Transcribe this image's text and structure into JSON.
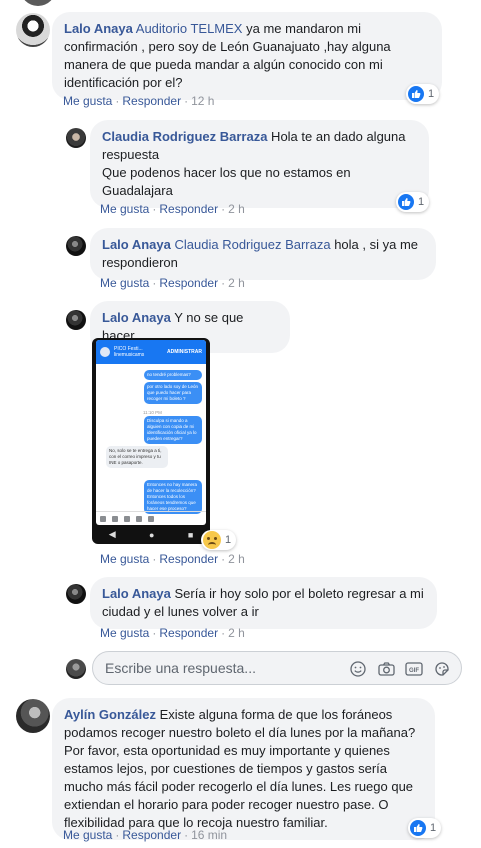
{
  "comments": [
    {
      "author": "Lalo Anaya",
      "mention": "Auditorio TELMEX",
      "text": " ya me mandaron mi confirmación , pero soy de León Guanajuato ,hay alguna manera de que pueda mandar a algún conocido con mi identificación por el?",
      "like_label": "Me gusta",
      "reply_label": "Responder",
      "time": "12 h",
      "reaction_count": "1"
    },
    {
      "author": "Claudia Rodriguez Barraza",
      "text_line1": " Hola te an dado alguna respuesta",
      "text_line2": "Que podenos hacer los que no estamos en Guadalajara",
      "like_label": "Me gusta",
      "reply_label": "Responder",
      "time": "2 h",
      "reaction_count": "1"
    },
    {
      "author": "Lalo Anaya",
      "mention": "Claudia Rodriguez Barraza",
      "text": " hola , si ya me respondieron",
      "like_label": "Me gusta",
      "reply_label": "Responder",
      "time": "2 h"
    },
    {
      "author": "Lalo Anaya",
      "text": " Y no se que hacer",
      "like_label": "Me gusta",
      "reply_label": "Responder",
      "time": "2 h",
      "reaction_count": "1"
    },
    {
      "author": "Lalo Anaya",
      "text": " Sería ir hoy solo por el boleto regresar a mi ciudad y el lunes volver a ir",
      "like_label": "Me gusta",
      "reply_label": "Responder",
      "time": "2 h"
    },
    {
      "author": "Aylín González",
      "text": " Existe alguna forma de que los foráneos podamos recoger nuestro boleto el día lunes por la mañana? Por favor, esta oportunidad es muy importante y quienes estamos lejos, por cuestiones de tiempos y gastos sería mucho más fácil poder recogerlo el día lunes. Les ruego que extiendan el horario para poder recoger nuestro pase. O flexibilidad para que lo recoja nuestro familiar.",
      "like_label": "Me gusta",
      "reply_label": "Responder",
      "time": "16 min",
      "reaction_count": "1"
    }
  ],
  "screenshot": {
    "header_name": "PICO Festi...\nlinemusicams",
    "header_right": "ADMINISTRAR",
    "messages": {
      "m1": "no tendré problemas?",
      "m2": "por otro lado soy de León que puedo hacer para recoger mi boleto ?",
      "time": "11:10 PM",
      "m3": "Disculpa si mando a alguien con copia de mi identificación oficial ya lo pueden entregar?",
      "m4": "No, solo se te entrega a ti, con el correo impreso y tu INE o pasaporte.",
      "m5": "Entonces no hay manera de hacer la recolección? Entonces todos los foráneos tendremos que hacer ese proceso?"
    },
    "reaction_count": "1"
  },
  "reply_box": {
    "placeholder": "Escribe una respuesta..."
  },
  "icons": [
    "emoji-icon",
    "camera-icon",
    "gif-icon",
    "sticker-icon",
    "like-icon",
    "sad-icon"
  ],
  "colors": {
    "link": "#385898",
    "bubble": "#f2f3f5",
    "like": "#1877f2",
    "meta": "#90949c"
  }
}
